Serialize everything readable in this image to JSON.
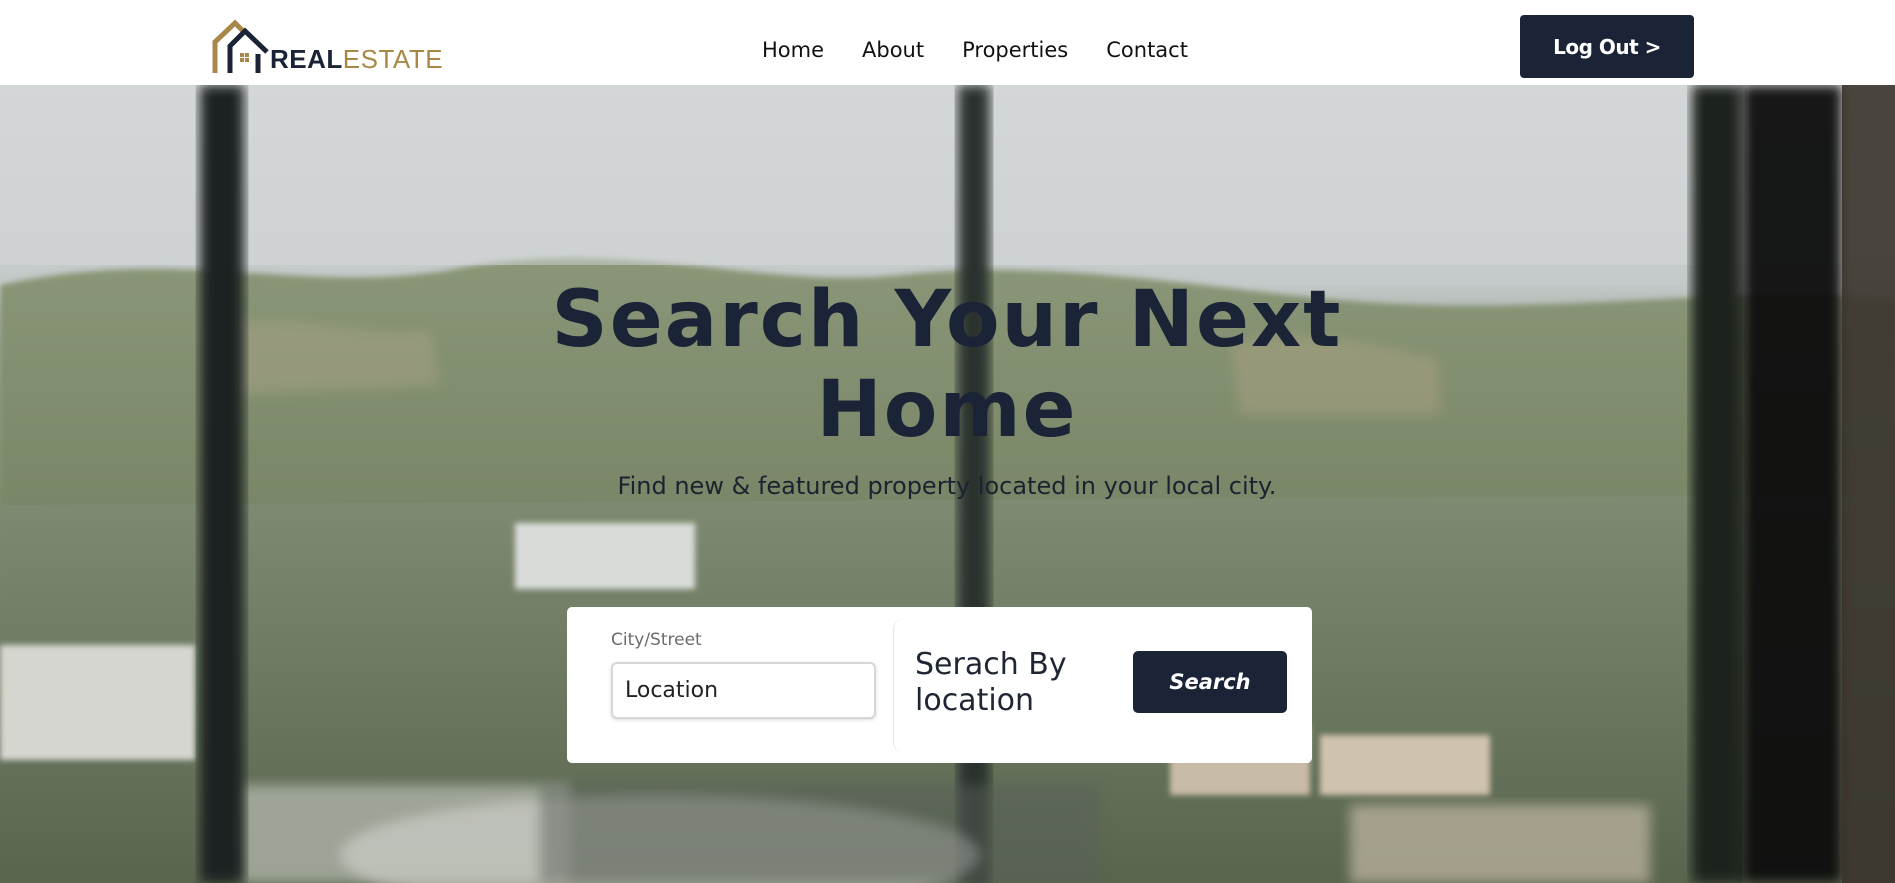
{
  "colors": {
    "primary": "#1b2336",
    "gold": "#a88749",
    "white": "#ffffff"
  },
  "header": {
    "logo": {
      "text_real": "REAL",
      "text_estate": "ESTATE",
      "icon": "house-logo-icon"
    },
    "nav": [
      "Home",
      "About",
      "Properties",
      "Contact"
    ],
    "logout_label": "Log Out >"
  },
  "hero": {
    "title_line1": "Search Your Next",
    "title_line2": "Home",
    "subtitle": "Find new & featured property located in your local city.",
    "search": {
      "field_label": "City/Street",
      "input_placeholder": "Location",
      "input_value": "",
      "hint": "Serach By location",
      "button_label": "Search"
    }
  }
}
